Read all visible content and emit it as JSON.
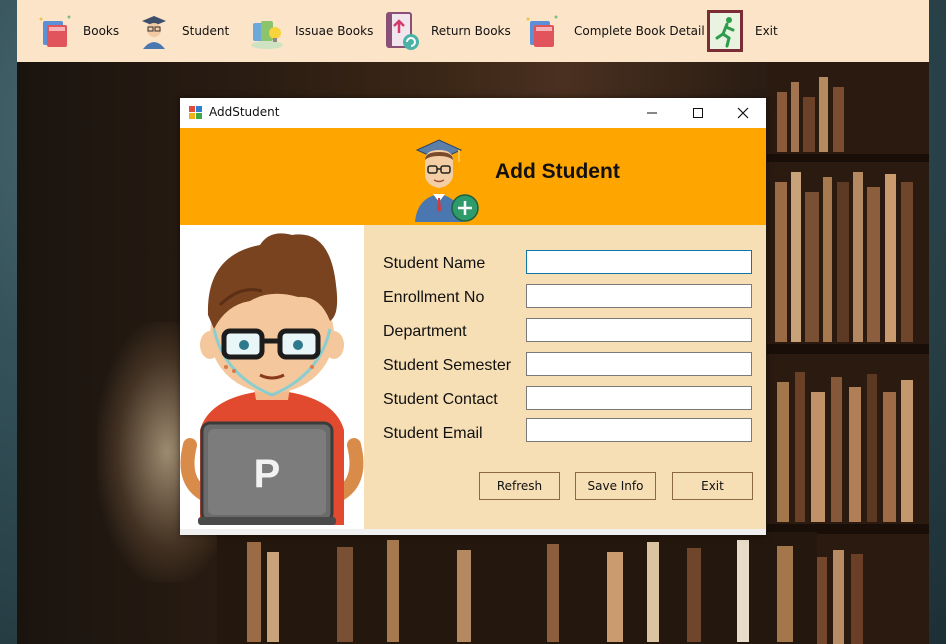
{
  "menubar": {
    "items": [
      {
        "label": "Books",
        "icon": "books-icon"
      },
      {
        "label": "Student",
        "icon": "student-icon"
      },
      {
        "label": "Issuae Books",
        "icon": "issue-books-icon"
      },
      {
        "label": "Return Books",
        "icon": "return-books-icon"
      },
      {
        "label": "Complete Book Detail",
        "icon": "book-detail-icon"
      },
      {
        "label": "Exit",
        "icon": "exit-icon"
      }
    ]
  },
  "window": {
    "title": "AddStudent",
    "header_title": "Add Student",
    "accent": "#fea500",
    "form_bg": "#f6deb5"
  },
  "form": {
    "fields": [
      {
        "label": "Student Name",
        "value": ""
      },
      {
        "label": "Enrollment No",
        "value": ""
      },
      {
        "label": "Department",
        "value": ""
      },
      {
        "label": "Student Semester",
        "value": ""
      },
      {
        "label": "Student Contact",
        "value": ""
      },
      {
        "label": "Student Email",
        "value": ""
      }
    ],
    "buttons": {
      "refresh": "Refresh",
      "save": "Save Info",
      "exit": "Exit"
    }
  },
  "illustration": {
    "laptop_letter": "P"
  }
}
